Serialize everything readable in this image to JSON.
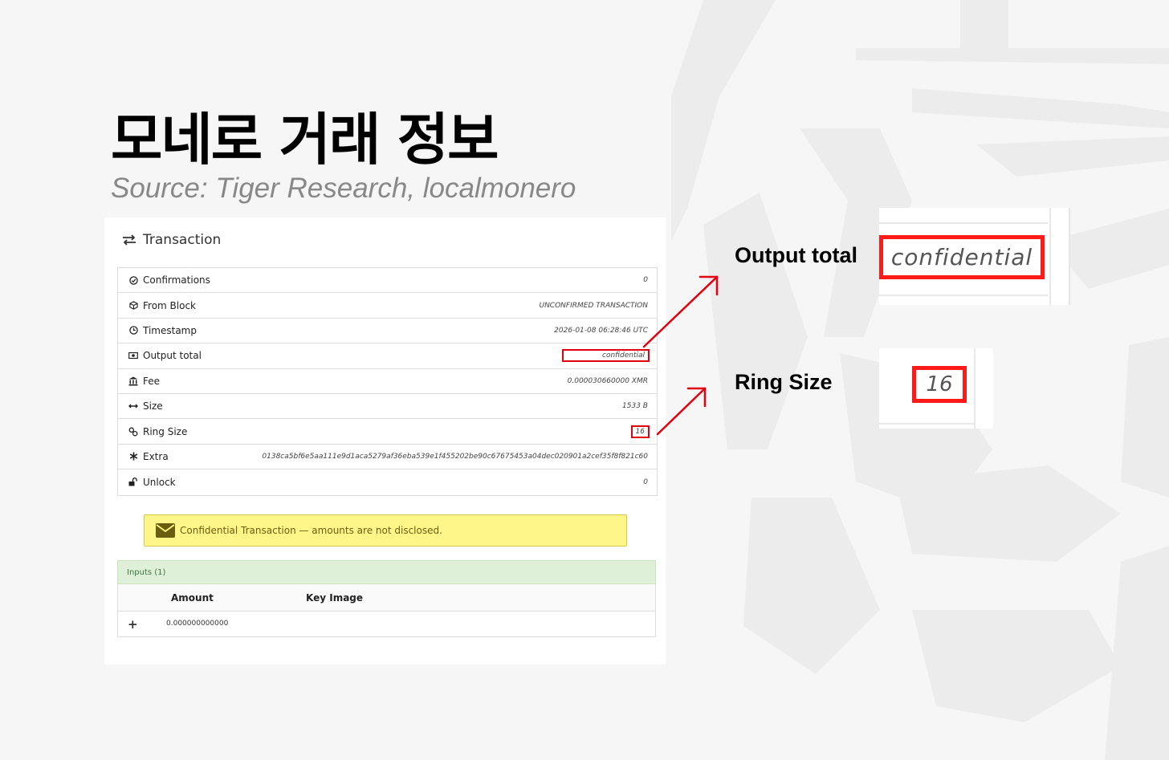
{
  "slide": {
    "title": "모네로 거래 정보",
    "subtitle": "Source: Tiger Research, localmonero"
  },
  "panel": {
    "header": "Transaction",
    "header_icon": "exchange-arrows-icon",
    "rows": [
      {
        "icon": "check-circle-icon",
        "label": "Confirmations",
        "value": "0"
      },
      {
        "icon": "cube-icon",
        "label": "From Block",
        "value": "UNCONFIRMED TRANSACTION"
      },
      {
        "icon": "clock-icon",
        "label": "Timestamp",
        "value": "2026-01-08 06:28:46 UTC"
      },
      {
        "icon": "money-icon",
        "label": "Output total",
        "value": "confidential"
      },
      {
        "icon": "bank-icon",
        "label": "Fee",
        "value": "0.000030660000 XMR"
      },
      {
        "icon": "horizontal-arrows-icon",
        "label": "Size",
        "value": "1533 B"
      },
      {
        "icon": "link-icon",
        "label": "Ring Size",
        "value": "16"
      },
      {
        "icon": "asterisk-icon",
        "label": "Extra",
        "value": "0138ca5bf6e5aa111e9d1aca5279af36eba539e1f455202be90c67675453a04dec020901a2cef35f8f821c60"
      },
      {
        "icon": "unlock-icon",
        "label": "Unlock",
        "value": "0"
      }
    ],
    "notice": "Confidential Transaction — amounts are not disclosed.",
    "notice_icon": "envelope-icon",
    "inputs": {
      "header": "Inputs (1)",
      "columns": [
        "Amount",
        "Key Image"
      ],
      "rows": [
        {
          "expand": "+",
          "amount": "0.000000000000",
          "key_image": ""
        }
      ]
    }
  },
  "callouts": {
    "output_total": {
      "label": "Output total",
      "value": "confidential"
    },
    "ring_size": {
      "label": "Ring Size",
      "value": "16"
    }
  },
  "colors": {
    "highlight": "#e3000f",
    "notice_bg": "#fff68a",
    "inputs_bg": "#dff0d8"
  }
}
